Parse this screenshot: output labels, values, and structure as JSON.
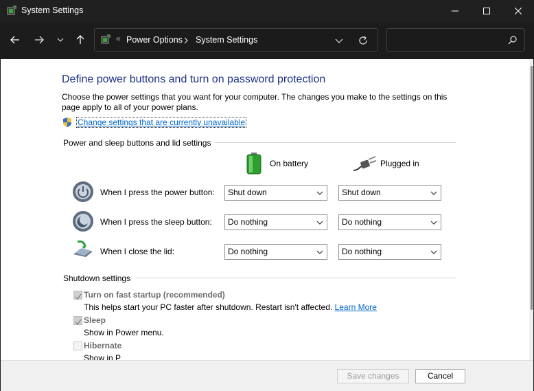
{
  "window": {
    "title": "System Settings"
  },
  "nav": {
    "crumbs": [
      "Power Options",
      "System Settings"
    ],
    "overflow_glyph": "«",
    "search_placeholder": ""
  },
  "page": {
    "title": "Define power buttons and turn on password protection",
    "description": "Choose the power settings that you want for your computer. The changes you make to the settings on this page apply to all of your power plans.",
    "change_link": "Change settings that are currently unavailable"
  },
  "power_section": {
    "label": "Power and sleep buttons and lid settings",
    "columns": [
      "On battery",
      "Plugged in"
    ],
    "rows": [
      {
        "label": "When I press the power button:",
        "on_battery": "Shut down",
        "plugged_in": "Shut down",
        "icon": "power-button-icon"
      },
      {
        "label": "When I press the sleep button:",
        "on_battery": "Do nothing",
        "plugged_in": "Do nothing",
        "icon": "sleep-button-icon"
      },
      {
        "label": "When I close the lid:",
        "on_battery": "Do nothing",
        "plugged_in": "Do nothing",
        "icon": "lid-close-icon"
      }
    ]
  },
  "shutdown_section": {
    "label": "Shutdown settings",
    "items": [
      {
        "label": "Turn on fast startup (recommended)",
        "checked": true,
        "description": "This helps start your PC faster after shutdown. Restart isn't affected.",
        "link": "Learn More"
      },
      {
        "label": "Sleep",
        "checked": true,
        "description": "Show in Power menu."
      },
      {
        "label": "Hibernate",
        "checked": false,
        "description": "Show in P"
      }
    ]
  },
  "buttons": {
    "save": "Save changes",
    "cancel": "Cancel"
  },
  "colors": {
    "title_blue": "#1e3287",
    "link_blue": "#0066cc",
    "titlebar": "#202020"
  }
}
